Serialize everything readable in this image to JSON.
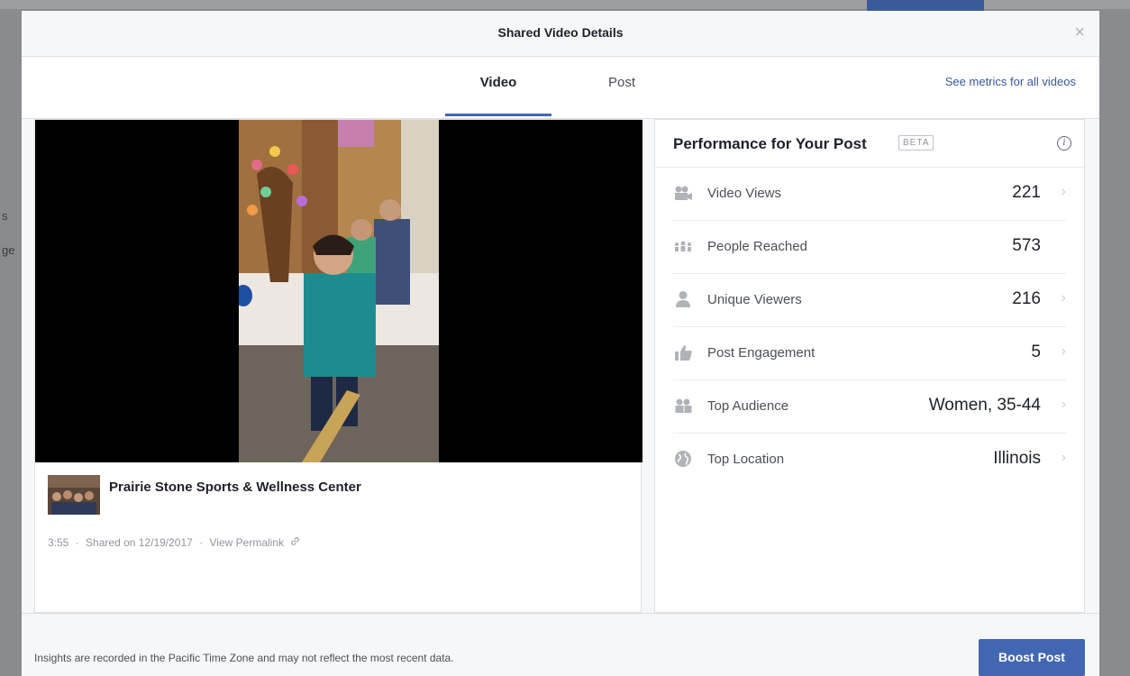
{
  "modal": {
    "title": "Shared Video Details",
    "close_glyph": "×"
  },
  "tabs": [
    {
      "label": "Video",
      "active": true
    },
    {
      "label": "Post",
      "active": false
    }
  ],
  "see_metrics_link": "See metrics for all videos",
  "video": {
    "page_name": "Prairie Stone Sports & Wellness Center",
    "duration": "3:55",
    "separator": "·",
    "shared_on": "Shared on 12/19/2017",
    "permalink": "View Permalink"
  },
  "performance": {
    "title": "Performance for Your Post",
    "badge": "BETA",
    "info_glyph": "i",
    "metrics": [
      {
        "icon": "video-camera-icon",
        "label": "Video Views",
        "value": "221",
        "has_chevron": true
      },
      {
        "icon": "people-group-icon",
        "label": "People Reached",
        "value": "573",
        "has_chevron": false
      },
      {
        "icon": "person-icon",
        "label": "Unique Viewers",
        "value": "216",
        "has_chevron": true
      },
      {
        "icon": "thumbs-up-icon",
        "label": "Post Engagement",
        "value": "5",
        "has_chevron": true
      },
      {
        "icon": "audience-icon",
        "label": "Top Audience",
        "value": "Women, 35-44",
        "has_chevron": true
      },
      {
        "icon": "globe-icon",
        "label": "Top Location",
        "value": "Illinois",
        "has_chevron": true
      }
    ],
    "chevron_glyph": "›"
  },
  "footer": {
    "note": "Insights are recorded in the Pacific Time Zone and may not reflect the most recent data.",
    "boost_label": "Boost Post"
  },
  "background": {
    "fragment_1": "s",
    "fragment_2": "ge"
  },
  "colors": {
    "accent": "#4267b2",
    "link": "#365899",
    "overlay": "#8a8b8e"
  }
}
